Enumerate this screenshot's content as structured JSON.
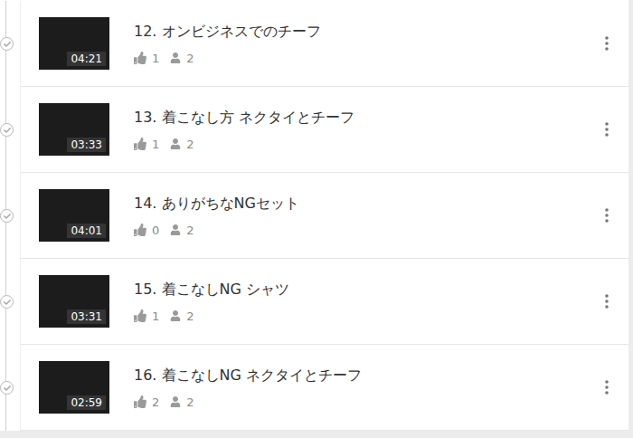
{
  "lessons": [
    {
      "title": "12. オンビジネスでのチーフ",
      "duration": "04:21",
      "likes": "1",
      "viewers": "2",
      "completed": true
    },
    {
      "title": "13. 着こなし方 ネクタイとチーフ",
      "duration": "03:33",
      "likes": "1",
      "viewers": "2",
      "completed": true
    },
    {
      "title": "14. ありがちなNGセット",
      "duration": "04:01",
      "likes": "0",
      "viewers": "2",
      "completed": true
    },
    {
      "title": "15. 着こなしNG シャツ",
      "duration": "03:31",
      "likes": "1",
      "viewers": "2",
      "completed": true
    },
    {
      "title": "16. 着こなしNG ネクタイとチーフ",
      "duration": "02:59",
      "likes": "2",
      "viewers": "2",
      "completed": true
    }
  ]
}
